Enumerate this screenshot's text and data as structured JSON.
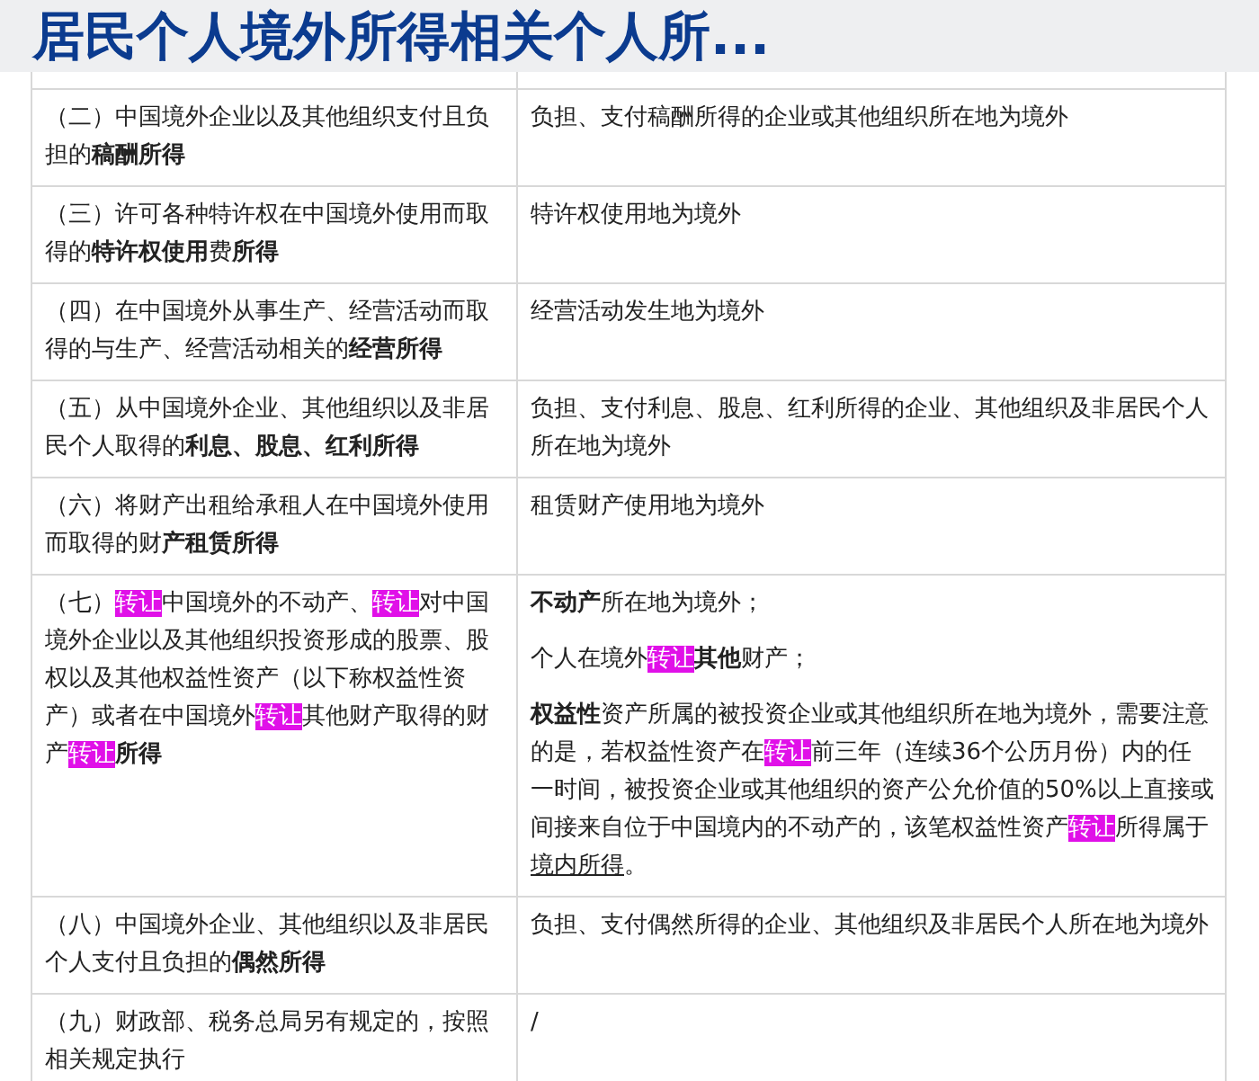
{
  "title": "居民个人境外所得相关个人所...",
  "rows": [
    {
      "left": [
        [
          {
            "text": "（二）中国境外企业以及其他组织支付且负担的"
          },
          {
            "text": "稿酬所得",
            "bold": true
          }
        ]
      ],
      "right": [
        [
          {
            "text": "负担、支付稿酬所得的企业或其他组织所在地为境外"
          }
        ]
      ]
    },
    {
      "left": [
        [
          {
            "text": "（三）许可各种特许权在中国境外使用而取得的"
          },
          {
            "text": "特许权使用",
            "bold": true
          },
          {
            "text": "费"
          },
          {
            "text": "所得",
            "bold": true
          }
        ]
      ],
      "right": [
        [
          {
            "text": "特许权使用地为境外"
          }
        ]
      ]
    },
    {
      "left": [
        [
          {
            "text": "（四）在中国境外从事生产、经营活动而取得的与生产、经营活动相关的"
          },
          {
            "text": "经营所得",
            "bold": true
          }
        ]
      ],
      "right": [
        [
          {
            "text": "经营活动发生地为境外"
          }
        ]
      ]
    },
    {
      "left": [
        [
          {
            "text": "（五）从中国境外企业、其他组织以及非居民个人取得的"
          },
          {
            "text": "利息、股息、红利所得",
            "bold": true
          }
        ]
      ],
      "right": [
        [
          {
            "text": "负担、支付利息、股息、红利所得的企业、其他组织及非居民个人所在地为境外"
          }
        ]
      ]
    },
    {
      "left": [
        [
          {
            "text": "（六）将财产出租给承租人在中国境外使用而取得的财"
          },
          {
            "text": "产租赁所得",
            "bold": true
          }
        ]
      ],
      "right": [
        [
          {
            "text": "租赁财产使用地为境外"
          }
        ]
      ]
    },
    {
      "left": [
        [
          {
            "text": "（七）"
          },
          {
            "text": "转让",
            "highlight": true
          },
          {
            "text": "中国境外的不动产、"
          },
          {
            "text": "转让",
            "highlight": true
          },
          {
            "text": "对中国境外企业以及其他组织投资形成的股票、股权以及其他权益性资产（以下称权益性资产）或者在中国境外"
          },
          {
            "text": "转让",
            "highlight": true
          },
          {
            "text": "其他财产取得的财产"
          },
          {
            "text": "转让",
            "highlight": true
          },
          {
            "text": "所得",
            "bold": true
          }
        ]
      ],
      "right": [
        [
          {
            "text": "不动产",
            "bold": true
          },
          {
            "text": "所在地为境外；"
          }
        ],
        [
          {
            "text": "个人在境外"
          },
          {
            "text": "转让",
            "highlight": true
          },
          {
            "text": "其他",
            "bold": true
          },
          {
            "text": "财产；"
          }
        ],
        [
          {
            "text": "权益性",
            "bold": true
          },
          {
            "text": "资产所属的被投资企业或其他组织所在地为境外，需要注意的是，若权益性资产在"
          },
          {
            "text": "转让",
            "highlight": true
          },
          {
            "text": "前三年（连续36个公历月份）内的任一时间，被投资企业或其他组织的资产公允价值的50%以上直接或间接来自位于中国境内的不动产的，该笔权益性资产"
          },
          {
            "text": "转让",
            "highlight": true
          },
          {
            "text": "所得属于"
          },
          {
            "text": "境内所得",
            "underline": true
          },
          {
            "text": "。"
          }
        ]
      ]
    },
    {
      "left": [
        [
          {
            "text": "（八）中国境外企业、其他组织以及非居民个人支付且负担的"
          },
          {
            "text": "偶然所得",
            "bold": true
          }
        ]
      ],
      "right": [
        [
          {
            "text": "负担、支付偶然所得的企业、其他组织及非居民个人所在地为境外"
          }
        ]
      ]
    },
    {
      "left": [
        [
          {
            "text": "（九）财政部、税务总局另有规定的，按照相关规定执行"
          }
        ]
      ],
      "right": [
        [
          {
            "text": "/"
          }
        ]
      ]
    }
  ]
}
